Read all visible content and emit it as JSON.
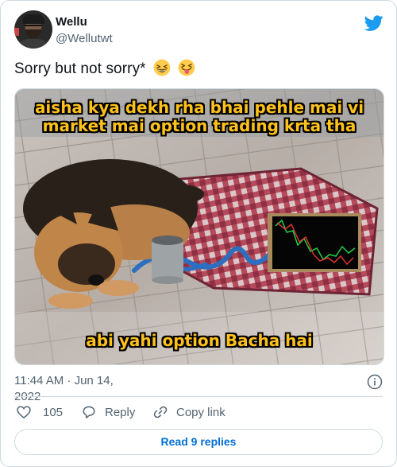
{
  "author": {
    "name": "Wellu",
    "handle": "@Wellutwt"
  },
  "tweet": {
    "text": "Sorry but not sorry*",
    "emojis": [
      "grinning-squinting-face-emoji",
      "squinting-face-with-tongue-emoji"
    ]
  },
  "media": {
    "caption_top_line1": "aisha kya dekh rha bhai pehle mai vi",
    "caption_top_line2": "market mai option trading krta tha",
    "caption_bottom": "abi yahi option Bacha hai"
  },
  "meta": {
    "timestamp": "11:44 AM · Jun 14, 2022"
  },
  "actions": {
    "like_count": "105",
    "reply_label": "Reply",
    "copy_label": "Copy link"
  },
  "footer": {
    "read_replies_label": "Read 9 replies"
  },
  "colors": {
    "brand": "#1d9bf0",
    "link": "#006fd6",
    "secondary_text": "#536471",
    "border": "#cfd9de",
    "caption": "#ffc21a"
  }
}
